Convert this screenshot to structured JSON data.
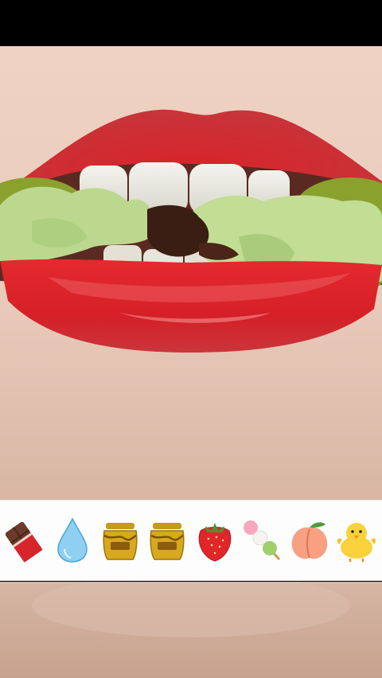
{
  "video": {
    "subject": "lips-biting-matcha-cookie"
  },
  "emoji_bar": {
    "items": [
      {
        "icon": "chocolate-bar-icon"
      },
      {
        "icon": "water-drop-icon"
      },
      {
        "icon": "honey-pot-icon"
      },
      {
        "icon": "honey-pot-icon"
      },
      {
        "icon": "strawberry-icon"
      },
      {
        "icon": "dango-icon"
      },
      {
        "icon": "peach-icon"
      },
      {
        "icon": "baby-chick-icon"
      }
    ]
  },
  "colors": {
    "skin": "#e8c7b6",
    "lip_red": "#d4262c",
    "matcha": "#b8d68a",
    "chocolate": "#3a1e14",
    "bar_bg": "#fdfdfd"
  }
}
